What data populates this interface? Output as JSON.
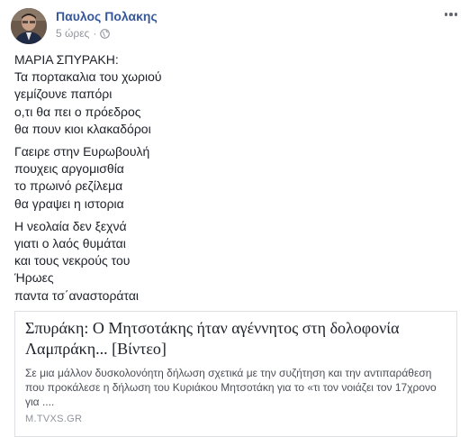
{
  "post": {
    "author": "Παυλος Πολακης",
    "time": "5 ώρες",
    "separator": "·",
    "privacy_icon": "globe-icon",
    "menu_icon": "more-options-icon"
  },
  "poem": {
    "heading": "ΜΑΡΙΑ ΣΠΥΡΑΚΗ:",
    "stanzas": [
      [
        "Τα πορτακαλια του χωριού",
        "γεμίζουνε παπόρι",
        "ο,τι θα πει ο πρόεδρος",
        "θα πουν κιοι κλακαδόροι"
      ],
      [
        "Γαειρε στην Ευρωβουλή",
        "πουχεις αργομισθία",
        "το πρωινό ρεζίλεμα",
        "θα γραψει η ιστορια"
      ],
      [
        "Η νεολαία δεν ξεχνά",
        "γιατι ο λαός θυμάται",
        "και τους νεκρούς του",
        "Ήρωες",
        "παντα τσ΄αναστοράται"
      ]
    ]
  },
  "link_card": {
    "title": "Σπυράκη: Ο Μητσοτάκης ήταν αγέννητος στη δολοφονία Λαμπράκη... [Βίντεο]",
    "description": "Σε μια μάλλον δυσκολονόητη δήλωση σχετικά με την συζήτηση και την αντιπαράθεση που προκάλεσε η δήλωση του Κυριάκου Μητσοτάκη για το «τι τον νοιάζει τον 17χρονο για ....",
    "domain": "M.TVXS.GR"
  }
}
